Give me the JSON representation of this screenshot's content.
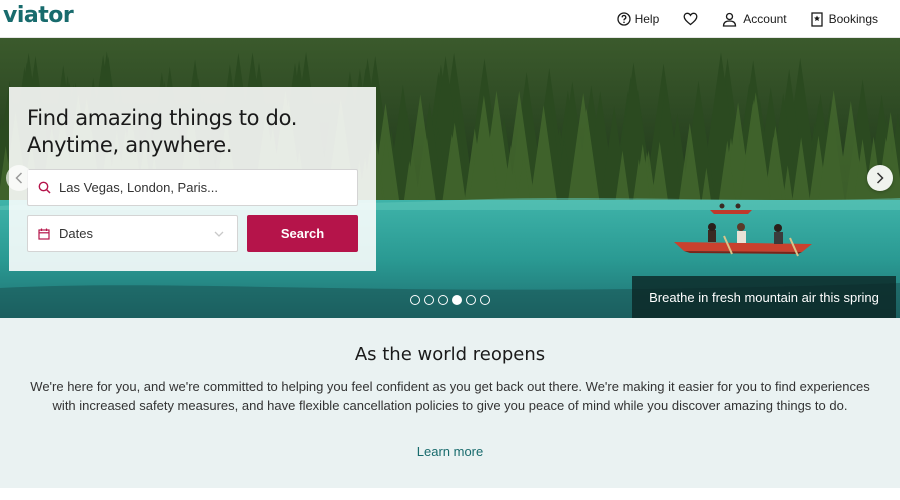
{
  "brand": {
    "logo_text": "viator",
    "color": "#186b6d",
    "accent": "#b5144a"
  },
  "nav": {
    "help_label": "Help",
    "account_label": "Account",
    "bookings_label": "Bookings"
  },
  "hero": {
    "headline_line1": "Find amazing things to do.",
    "headline_line2": "Anytime, anywhere.",
    "search_placeholder": "Las Vegas, London, Paris...",
    "dates_label": "Dates",
    "search_button": "Search",
    "caption": "Breathe in fresh mountain air this spring",
    "slides_count": 6,
    "active_slide": 4
  },
  "info": {
    "title": "As the world reopens",
    "body": "We're here for you, and we're committed to helping you feel confident as you get back out there. We're making it easier for you to find experiences with increased safety measures, and have flexible cancellation policies to give you peace of mind while you discover amazing things to do.",
    "link": "Learn more"
  }
}
